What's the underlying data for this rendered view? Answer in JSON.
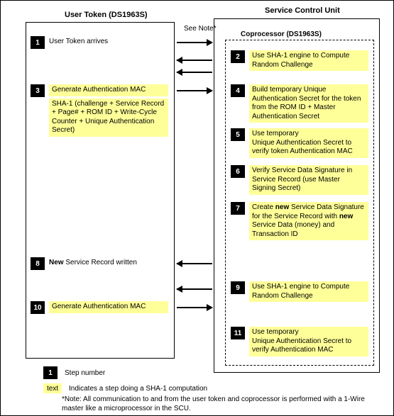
{
  "titles": {
    "left": "User Token (DS1963S)",
    "right": "Service Control Unit",
    "coprocessor": "Coprocessor (DS1963S)",
    "see_note": "See Note*"
  },
  "left_steps": {
    "s1": {
      "num": "1",
      "text": "User Token arrives"
    },
    "s3": {
      "num": "3",
      "text": "Generate Authentication MAC",
      "detail": "SHA-1 (challenge + Service Record + Page# + ROM ID + Write-Cycle Counter + Unique Authentication Secret)"
    },
    "s8": {
      "num": "8",
      "text": " Service Record written",
      "prefix": "New"
    },
    "s10": {
      "num": "10",
      "text": "Generate Authentication MAC"
    }
  },
  "right_steps": {
    "s2": {
      "num": "2",
      "text": "Use SHA-1 engine to Compute Random Challenge"
    },
    "s4": {
      "num": "4",
      "text": "Build temporary Unique Authentication Secret for the token from the ROM ID  + Master Authentication Secret"
    },
    "s5": {
      "num": "5",
      "text": "Use temporary\nUnique Authentication Secret to verify token Authentication MAC"
    },
    "s6": {
      "num": "6",
      "text": "Verify Service Data Signature in Service Record (use Master Signing Secret)"
    },
    "s7": {
      "num": "7",
      "pre": "Create ",
      "bold1": "new",
      "mid": " Service Data Signature for the Service Record with ",
      "bold2": "new",
      "post": " Service Data (money) and Transaction ID"
    },
    "s9": {
      "num": "9",
      "text": "Use SHA-1 engine to Compute Random Challenge"
    },
    "s11": {
      "num": "11",
      "text": "Use temporary\nUnique Authentication Secret to verify Authentication MAC"
    }
  },
  "legend": {
    "num": "1",
    "num_label": "Step number",
    "sha": "text",
    "sha_label": "Indicates a step doing a SHA-1 computation"
  },
  "note": "*Note: All communication to and from the user token and coprocessor is performed with a 1-Wire master like a microprocessor in the SCU."
}
